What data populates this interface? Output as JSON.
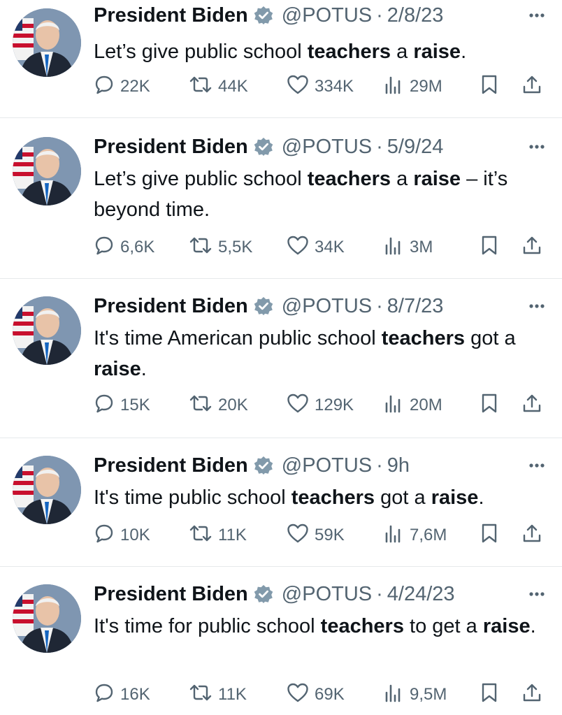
{
  "tweets": [
    {
      "author": "President Biden",
      "handle": "@POTUS",
      "separator": "·",
      "date": "2/8/23",
      "text": [
        {
          "t": "Let’s give public school ",
          "b": false
        },
        {
          "t": "teachers",
          "b": true
        },
        {
          "t": " a ",
          "b": false
        },
        {
          "t": "raise",
          "b": true
        },
        {
          "t": ".",
          "b": false
        }
      ],
      "replies": "22K",
      "retweets": "44K",
      "likes": "334K",
      "views": "29M"
    },
    {
      "author": "President Biden",
      "handle": "@POTUS",
      "separator": "·",
      "date": "5/9/24",
      "text": [
        {
          "t": "Let’s give public school ",
          "b": false
        },
        {
          "t": "teachers",
          "b": true
        },
        {
          "t": " a ",
          "b": false
        },
        {
          "t": "raise",
          "b": true
        },
        {
          "t": " – it’s beyond time.",
          "b": false
        }
      ],
      "replies": "6,6K",
      "retweets": "5,5K",
      "likes": "34K",
      "views": "3M"
    },
    {
      "author": "President Biden",
      "handle": "@POTUS",
      "separator": "·",
      "date": "8/7/23",
      "text": [
        {
          "t": "It's time American public school ",
          "b": false
        },
        {
          "t": "teachers",
          "b": true
        },
        {
          "t": " got a ",
          "b": false
        },
        {
          "t": "raise",
          "b": true
        },
        {
          "t": ".",
          "b": false
        }
      ],
      "replies": "15K",
      "retweets": "20K",
      "likes": "129K",
      "views": "20M"
    },
    {
      "author": "President Biden",
      "handle": "@POTUS",
      "separator": "·",
      "date": "9h",
      "text": [
        {
          "t": "It's time public school ",
          "b": false
        },
        {
          "t": "teachers",
          "b": true
        },
        {
          "t": " got a ",
          "b": false
        },
        {
          "t": "raise",
          "b": true
        },
        {
          "t": ".",
          "b": false
        }
      ],
      "replies": "10K",
      "retweets": "11K",
      "likes": "59K",
      "views": "7,6M"
    },
    {
      "author": "President Biden",
      "handle": "@POTUS",
      "separator": "·",
      "date": "4/24/23",
      "text": [
        {
          "t": "It's time for public school ",
          "b": false
        },
        {
          "t": "teachers",
          "b": true
        },
        {
          "t": " to get a ",
          "b": false
        },
        {
          "t": "raise",
          "b": true
        },
        {
          "t": ".",
          "b": false
        }
      ],
      "replies": "16K",
      "retweets": "11K",
      "likes": "69K",
      "views": "9,5M"
    }
  ],
  "colors": {
    "text": "#0f1419",
    "secondary": "#536471",
    "verified": "#829aab",
    "divider": "#e6e9eb"
  },
  "icons": {
    "reply": "reply-icon",
    "retweet": "retweet-icon",
    "like": "heart-icon",
    "views": "views-icon",
    "bookmark": "bookmark-icon",
    "share": "share-icon",
    "more": "more-icon",
    "verified": "verified-badge-icon"
  }
}
